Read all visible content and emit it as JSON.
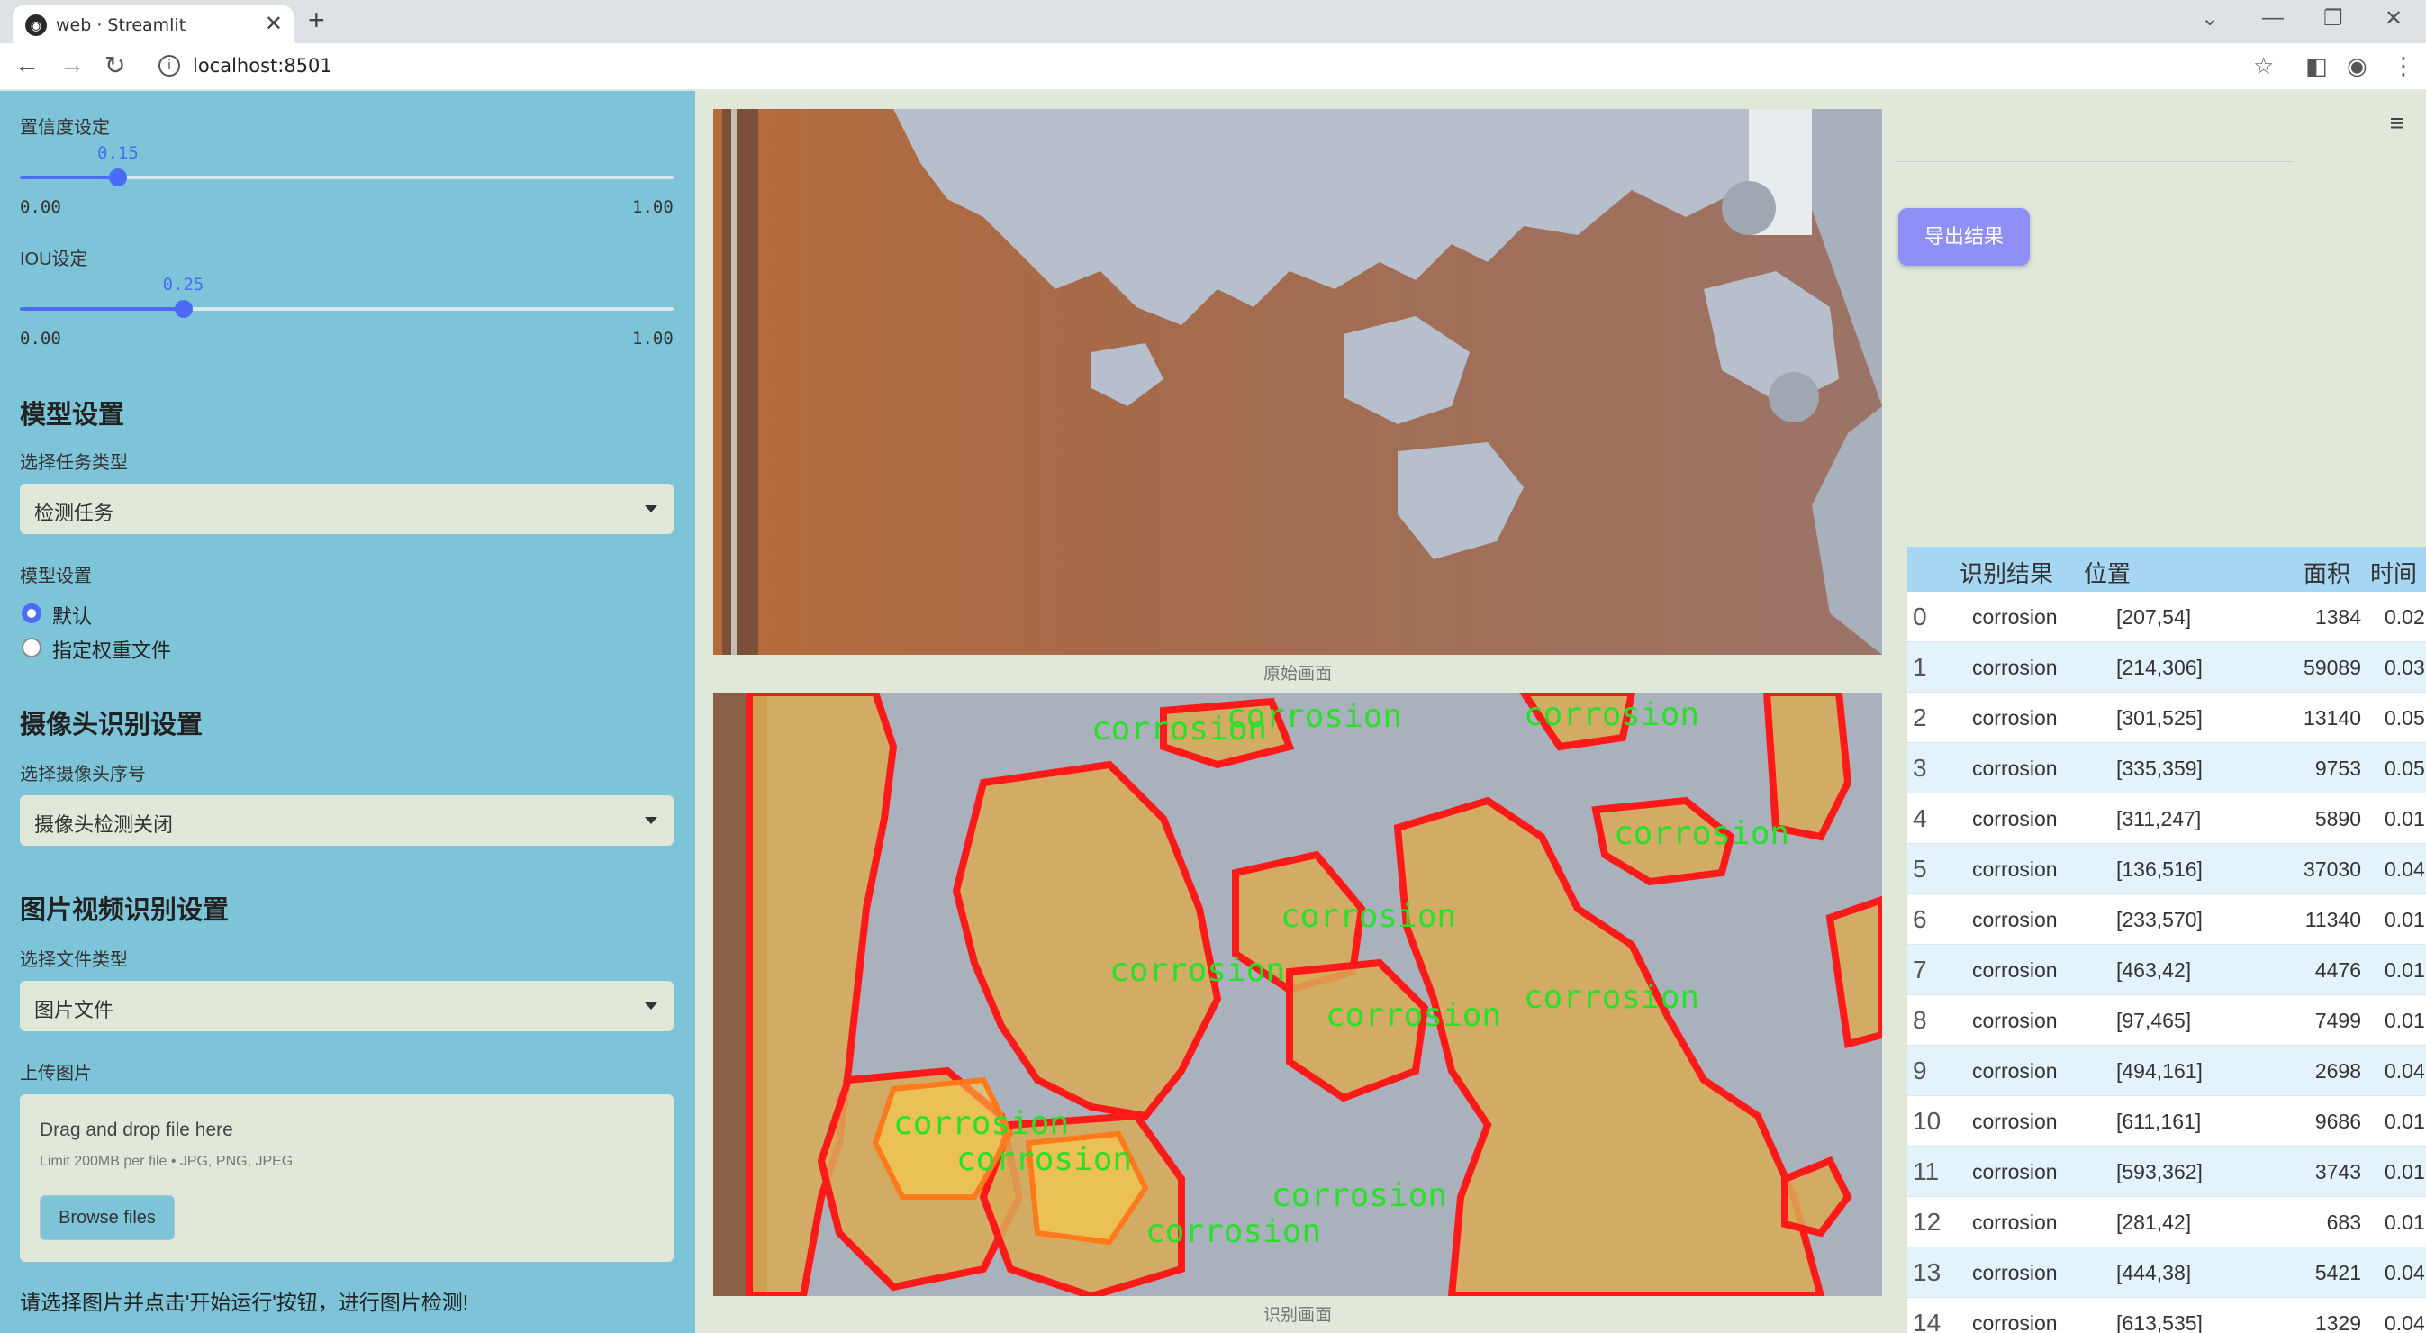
{
  "browser": {
    "tab_title": "web · Streamlit",
    "url": "localhost:8501"
  },
  "sidebar": {
    "confidence": {
      "label": "置信度设定",
      "value": "0.15",
      "min": "0.00",
      "max": "1.00",
      "fraction": 0.15
    },
    "iou": {
      "label": "IOU设定",
      "value": "0.25",
      "min": "0.00",
      "max": "1.00",
      "fraction": 0.25
    },
    "model_section": "模型设置",
    "task_label": "选择任务类型",
    "task_value": "检测任务",
    "model_label": "模型设置",
    "model_options": [
      "默认",
      "指定权重文件"
    ],
    "camera_section": "摄像头识别设置",
    "camera_label": "选择摄像头序号",
    "camera_value": "摄像头检测关闭",
    "media_section": "图片视频识别设置",
    "filetype_label": "选择文件类型",
    "filetype_value": "图片文件",
    "upload_label": "上传图片",
    "upload_title": "Drag and drop file here",
    "upload_limit": "Limit 200MB per file • JPG, PNG, JPEG",
    "browse_label": "Browse files",
    "hint": "请选择图片并点击'开始运行'按钮，进行图片检测!"
  },
  "main": {
    "caption_original": "原始画面",
    "caption_result": "识别画面",
    "export_label": "导出结果",
    "overlay_label": "corrosion",
    "table": {
      "headers": [
        "识别结果",
        "位置",
        "面积",
        "时间"
      ],
      "rows": [
        {
          "idx": "0",
          "cls": "corrosion",
          "pos": "[207,54]",
          "area": "1384",
          "time": "0.02"
        },
        {
          "idx": "1",
          "cls": "corrosion",
          "pos": "[214,306]",
          "area": "59089",
          "time": "0.03"
        },
        {
          "idx": "2",
          "cls": "corrosion",
          "pos": "[301,525]",
          "area": "13140",
          "time": "0.05"
        },
        {
          "idx": "3",
          "cls": "corrosion",
          "pos": "[335,359]",
          "area": "9753",
          "time": "0.05"
        },
        {
          "idx": "4",
          "cls": "corrosion",
          "pos": "[311,247]",
          "area": "5890",
          "time": "0.01"
        },
        {
          "idx": "5",
          "cls": "corrosion",
          "pos": "[136,516]",
          "area": "37030",
          "time": "0.04"
        },
        {
          "idx": "6",
          "cls": "corrosion",
          "pos": "[233,570]",
          "area": "11340",
          "time": "0.01"
        },
        {
          "idx": "7",
          "cls": "corrosion",
          "pos": "[463,42]",
          "area": "4476",
          "time": "0.01"
        },
        {
          "idx": "8",
          "cls": "corrosion",
          "pos": "[97,465]",
          "area": "7499",
          "time": "0.01"
        },
        {
          "idx": "9",
          "cls": "corrosion",
          "pos": "[494,161]",
          "area": "2698",
          "time": "0.04"
        },
        {
          "idx": "10",
          "cls": "corrosion",
          "pos": "[611,161]",
          "area": "9686",
          "time": "0.01"
        },
        {
          "idx": "11",
          "cls": "corrosion",
          "pos": "[593,362]",
          "area": "3743",
          "time": "0.01"
        },
        {
          "idx": "12",
          "cls": "corrosion",
          "pos": "[281,42]",
          "area": "683",
          "time": "0.01"
        },
        {
          "idx": "13",
          "cls": "corrosion",
          "pos": "[444,38]",
          "area": "5421",
          "time": "0.04"
        },
        {
          "idx": "14",
          "cls": "corrosion",
          "pos": "[613,535]",
          "area": "1329",
          "time": "0.04"
        }
      ]
    }
  },
  "colors": {
    "sidebar_bg": "#7ec4d8",
    "main_bg": "#dfe8d9",
    "accent": "#4a6cf7",
    "export_btn": "#8f8ff5",
    "table_header": "#a6d6f2",
    "mask_outline": "#ff1a1a",
    "label_text": "#2adf2a"
  }
}
